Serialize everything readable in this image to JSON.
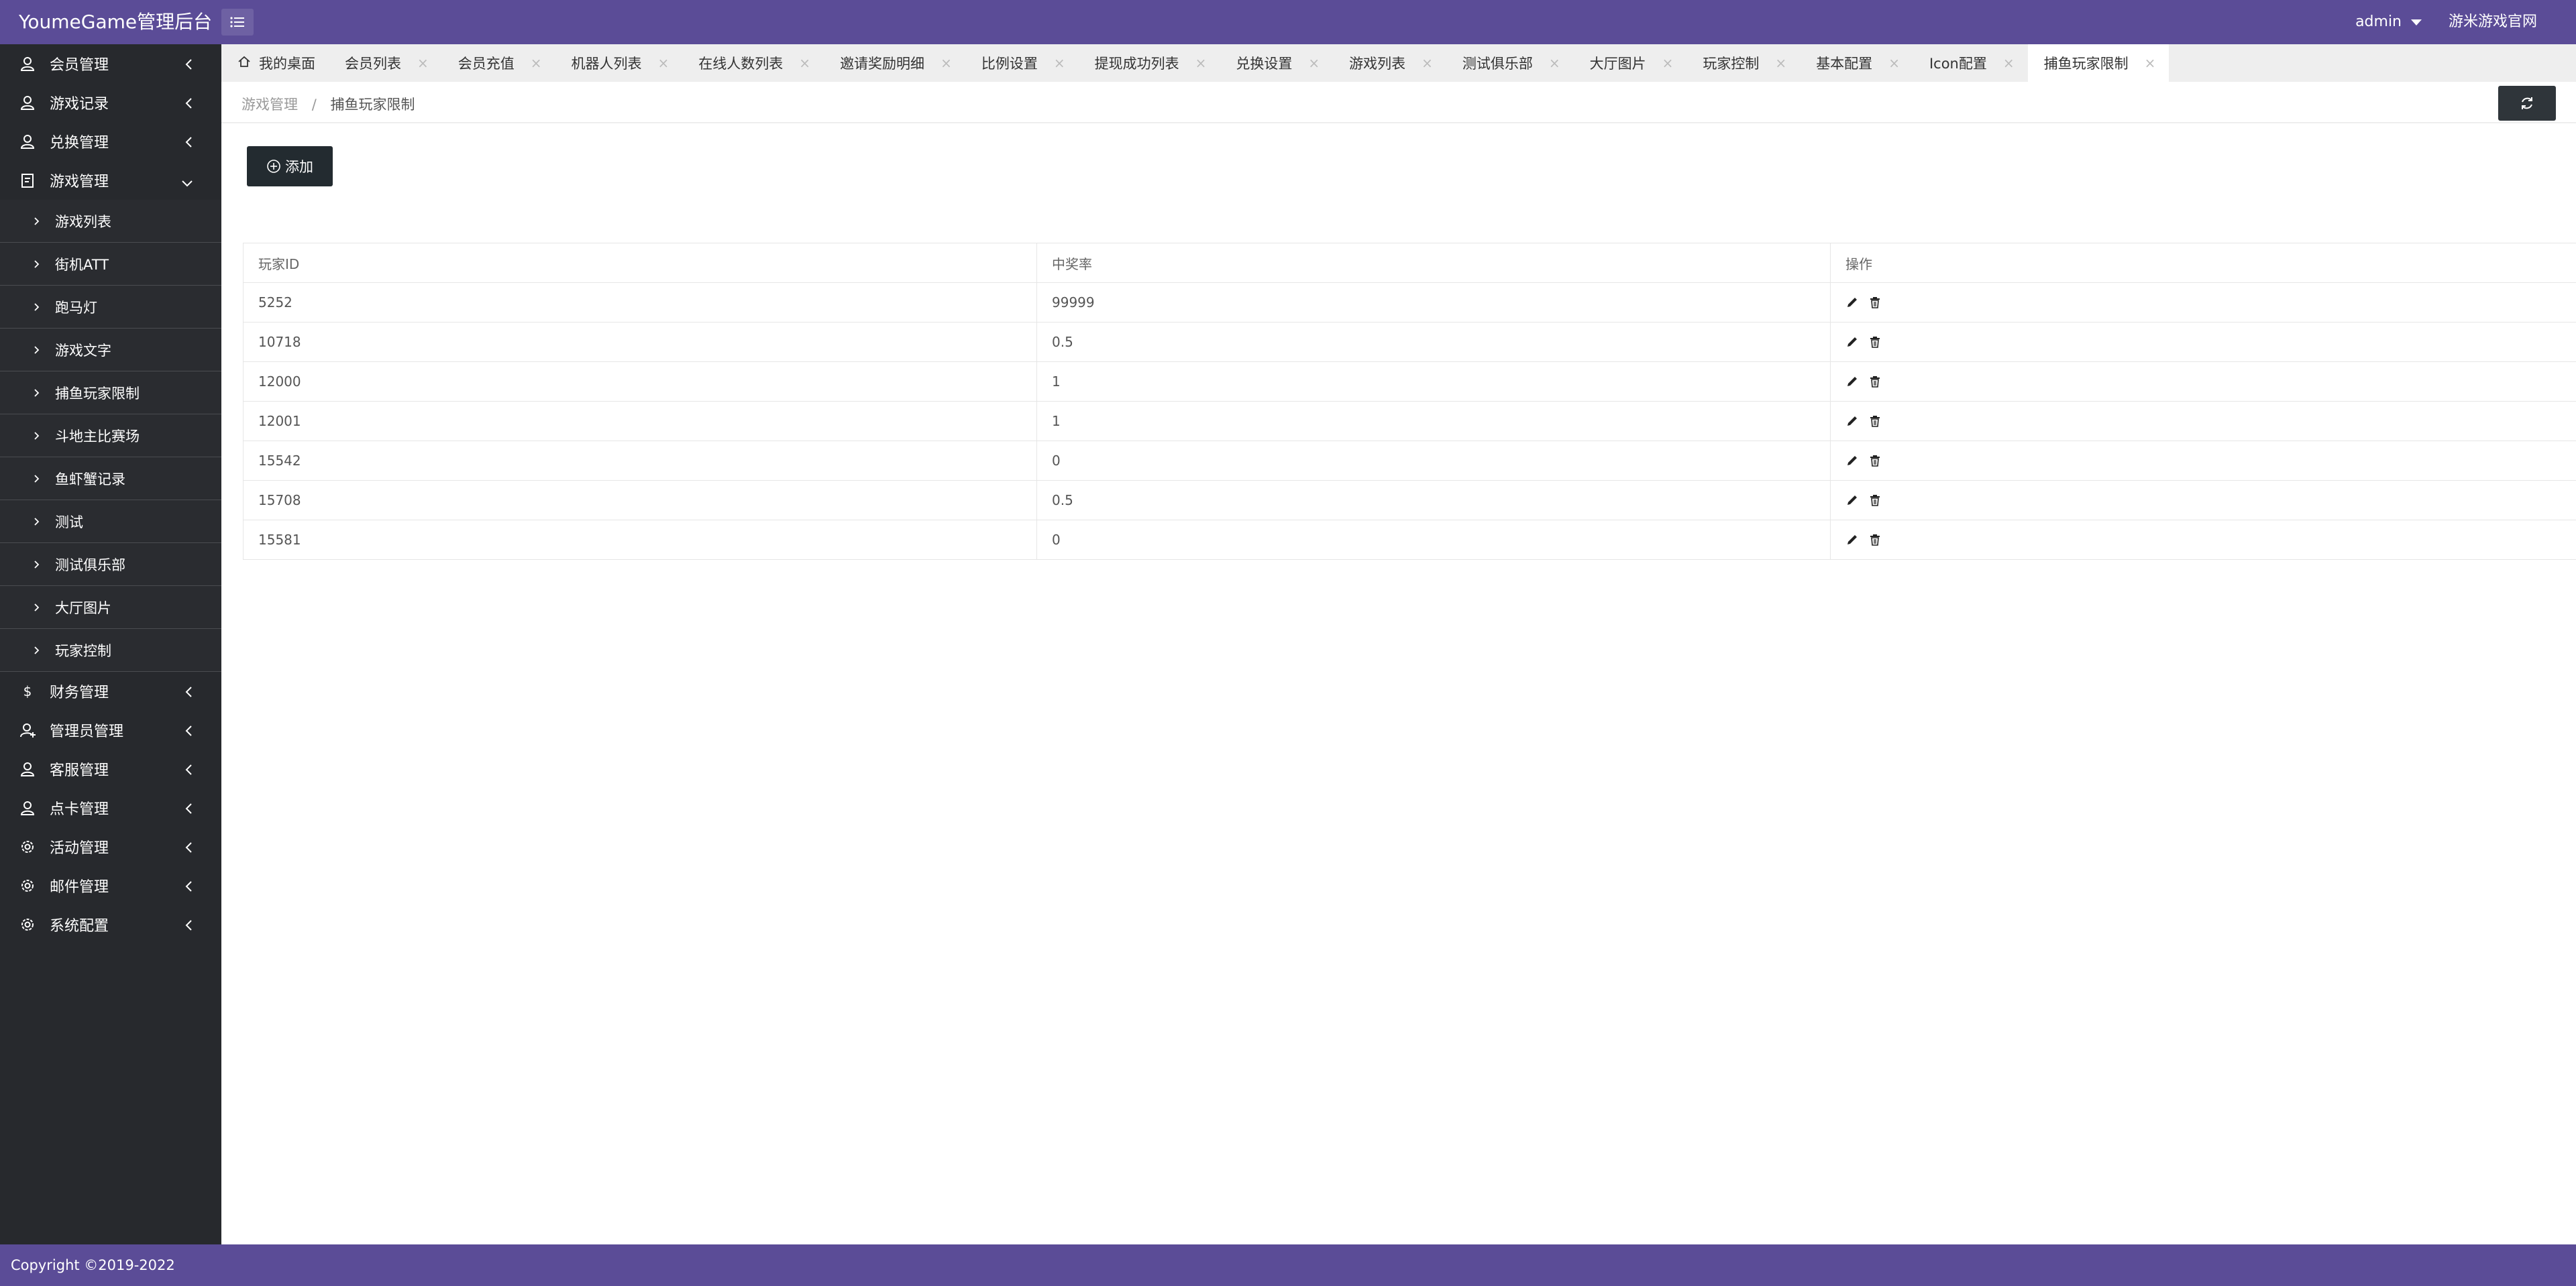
{
  "header": {
    "logo": "YoumeGame管理后台",
    "user": "admin",
    "site_link": "游米游戏官网"
  },
  "sidebar": {
    "groups_top": [
      {
        "label": "会员管理",
        "icon": "user-icon"
      },
      {
        "label": "游戏记录",
        "icon": "user-icon"
      },
      {
        "label": "兑换管理",
        "icon": "user-icon"
      },
      {
        "label": "游戏管理",
        "icon": "clipboard-icon"
      }
    ],
    "sub_items": [
      "游戏列表",
      "街机ATT",
      "跑马灯",
      "游戏文字",
      "捕鱼玩家限制",
      "斗地主比赛场",
      "鱼虾蟹记录",
      "测试",
      "测试俱乐部",
      "大厅图片",
      "玩家控制"
    ],
    "groups_bottom": [
      {
        "label": "财务管理",
        "icon": "dollar-icon"
      },
      {
        "label": "管理员管理",
        "icon": "user-admin-icon"
      },
      {
        "label": "客服管理",
        "icon": "user-icon"
      },
      {
        "label": "点卡管理",
        "icon": "user-icon"
      },
      {
        "label": "活动管理",
        "icon": "gear-icon"
      },
      {
        "label": "邮件管理",
        "icon": "gear-icon"
      },
      {
        "label": "系统配置",
        "icon": "gear-icon"
      }
    ]
  },
  "tabs": [
    "我的桌面",
    "会员列表",
    "会员充值",
    "机器人列表",
    "在线人数列表",
    "邀请奖励明细",
    "比例设置",
    "提现成功列表",
    "兑换设置",
    "游戏列表",
    "测试俱乐部",
    "大厅图片",
    "玩家控制",
    "基本配置",
    "Icon配置",
    "捕鱼玩家限制"
  ],
  "breadcrumb": {
    "parent": "游戏管理",
    "separator": "/",
    "current": "捕鱼玩家限制"
  },
  "add_button": "添加",
  "table": {
    "headers": [
      "玩家ID",
      "中奖率",
      "操作"
    ],
    "rows": [
      [
        "5252",
        "99999"
      ],
      [
        "10718",
        "0.5"
      ],
      [
        "12000",
        "1"
      ],
      [
        "12001",
        "1"
      ],
      [
        "15542",
        "0"
      ],
      [
        "15708",
        "0.5"
      ],
      [
        "15581",
        "0"
      ]
    ]
  },
  "footer": "Copyright ©2019-2022",
  "colors": {
    "header_bg": "#5b4c97",
    "sidebar_bg": "#27292d",
    "button_dark": "#232b30"
  }
}
